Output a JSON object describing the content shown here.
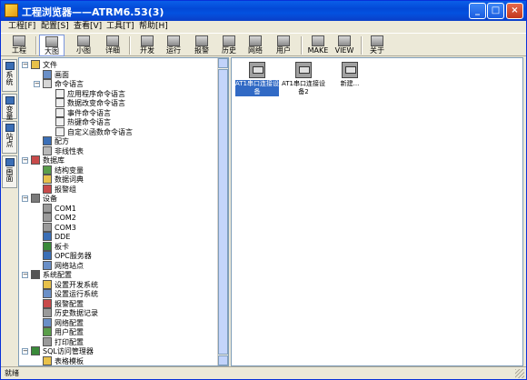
{
  "window": {
    "title": "工程浏览器——ATRM6.53(3)",
    "minimize": "_",
    "maximize": "□",
    "close": "×"
  },
  "menu": [
    "工程[F]",
    "配置[S]",
    "查看[V]",
    "工具[T]",
    "帮助[H]"
  ],
  "toolbar": [
    "工程",
    "大图",
    "小图",
    "详细",
    "开发",
    "运行",
    "报警",
    "历史",
    "网络",
    "用户",
    "MAKE",
    "VIEW",
    "关于"
  ],
  "toolbar_active": "大图",
  "left_tabs": [
    "系统",
    "变量",
    "站点",
    "画面"
  ],
  "tree": [
    {
      "level": 0,
      "exp": "−",
      "label": "文件",
      "icon": "folder-icon",
      "color": "#e8c14a"
    },
    {
      "level": 1,
      "exp": "",
      "label": "画面",
      "icon": "screen-icon",
      "color": "#6a8fc7"
    },
    {
      "level": 1,
      "exp": "−",
      "label": "命令语言",
      "icon": "script-icon",
      "color": "#d6d6d6"
    },
    {
      "level": 2,
      "exp": "",
      "label": "应用程序命令语言",
      "icon": "document-icon",
      "color": "#f0f0f0"
    },
    {
      "level": 2,
      "exp": "",
      "label": "数据改变命令语言",
      "icon": "document-icon",
      "color": "#f0f0f0"
    },
    {
      "level": 2,
      "exp": "",
      "label": "事件命令语言",
      "icon": "document-icon",
      "color": "#f0f0f0"
    },
    {
      "level": 2,
      "exp": "",
      "label": "热键命令语言",
      "icon": "document-icon",
      "color": "#f0f0f0"
    },
    {
      "level": 2,
      "exp": "",
      "label": "自定义函数命令语言",
      "icon": "document-icon",
      "color": "#f0f0f0"
    },
    {
      "level": 1,
      "exp": "",
      "label": "配方",
      "icon": "recipe-icon",
      "color": "#3b6fb6"
    },
    {
      "level": 1,
      "exp": "",
      "label": "非线性表",
      "icon": "table-icon",
      "color": "#b8b8b8"
    },
    {
      "level": 0,
      "exp": "−",
      "label": "数据库",
      "icon": "database-icon",
      "color": "#c84a4a"
    },
    {
      "level": 1,
      "exp": "",
      "label": "结构变量",
      "icon": "struct-icon",
      "color": "#5a9e4a"
    },
    {
      "level": 1,
      "exp": "",
      "label": "数据词典",
      "icon": "dictionary-icon",
      "color": "#e8c14a"
    },
    {
      "level": 1,
      "exp": "",
      "label": "报警组",
      "icon": "alarm-icon",
      "color": "#c84a4a"
    },
    {
      "level": 0,
      "exp": "−",
      "label": "设备",
      "icon": "device-icon",
      "color": "#7a7a7a"
    },
    {
      "level": 1,
      "exp": "",
      "label": "COM1",
      "icon": "port-icon",
      "color": "#9a9a9a"
    },
    {
      "level": 1,
      "exp": "",
      "label": "COM2",
      "icon": "port-icon",
      "color": "#9a9a9a"
    },
    {
      "level": 1,
      "exp": "",
      "label": "COM3",
      "icon": "port-icon",
      "color": "#9a9a9a"
    },
    {
      "level": 1,
      "exp": "",
      "label": "DDE",
      "icon": "dde-icon",
      "color": "#3b6fb6"
    },
    {
      "level": 1,
      "exp": "",
      "label": "板卡",
      "icon": "board-icon",
      "color": "#3a8a3a"
    },
    {
      "level": 1,
      "exp": "",
      "label": "OPC服务器",
      "icon": "opc-icon",
      "color": "#3b6fb6"
    },
    {
      "level": 1,
      "exp": "",
      "label": "网络站点",
      "icon": "network-icon",
      "color": "#6a8fc7"
    },
    {
      "level": 0,
      "exp": "−",
      "label": "系统配置",
      "icon": "tools-icon",
      "color": "#555555"
    },
    {
      "level": 1,
      "exp": "",
      "label": "设置开发系统",
      "icon": "settings-icon",
      "color": "#e8c14a"
    },
    {
      "level": 1,
      "exp": "",
      "label": "设置运行系统",
      "icon": "settings-icon",
      "color": "#6a8fc7"
    },
    {
      "level": 1,
      "exp": "",
      "label": "报警配置",
      "icon": "alarm-icon",
      "color": "#c84a4a"
    },
    {
      "level": 1,
      "exp": "",
      "label": "历史数据记录",
      "icon": "history-icon",
      "color": "#9a9a9a"
    },
    {
      "level": 1,
      "exp": "",
      "label": "网络配置",
      "icon": "network-icon",
      "color": "#6a8fc7"
    },
    {
      "level": 1,
      "exp": "",
      "label": "用户配置",
      "icon": "user-icon",
      "color": "#5a9e4a"
    },
    {
      "level": 1,
      "exp": "",
      "label": "打印配置",
      "icon": "printer-icon",
      "color": "#9a9a9a"
    },
    {
      "level": 0,
      "exp": "−",
      "label": "SQL访问管理器",
      "icon": "sql-icon",
      "color": "#3a8a3a"
    },
    {
      "level": 1,
      "exp": "",
      "label": "表格模板",
      "icon": "table-icon",
      "color": "#e8c14a"
    }
  ],
  "devices": [
    {
      "label": "AT1串口连接设备",
      "selected": true
    },
    {
      "label": "AT1串口连接设备2",
      "selected": false
    },
    {
      "label": "新建...",
      "selected": false
    }
  ],
  "status": "就绪"
}
